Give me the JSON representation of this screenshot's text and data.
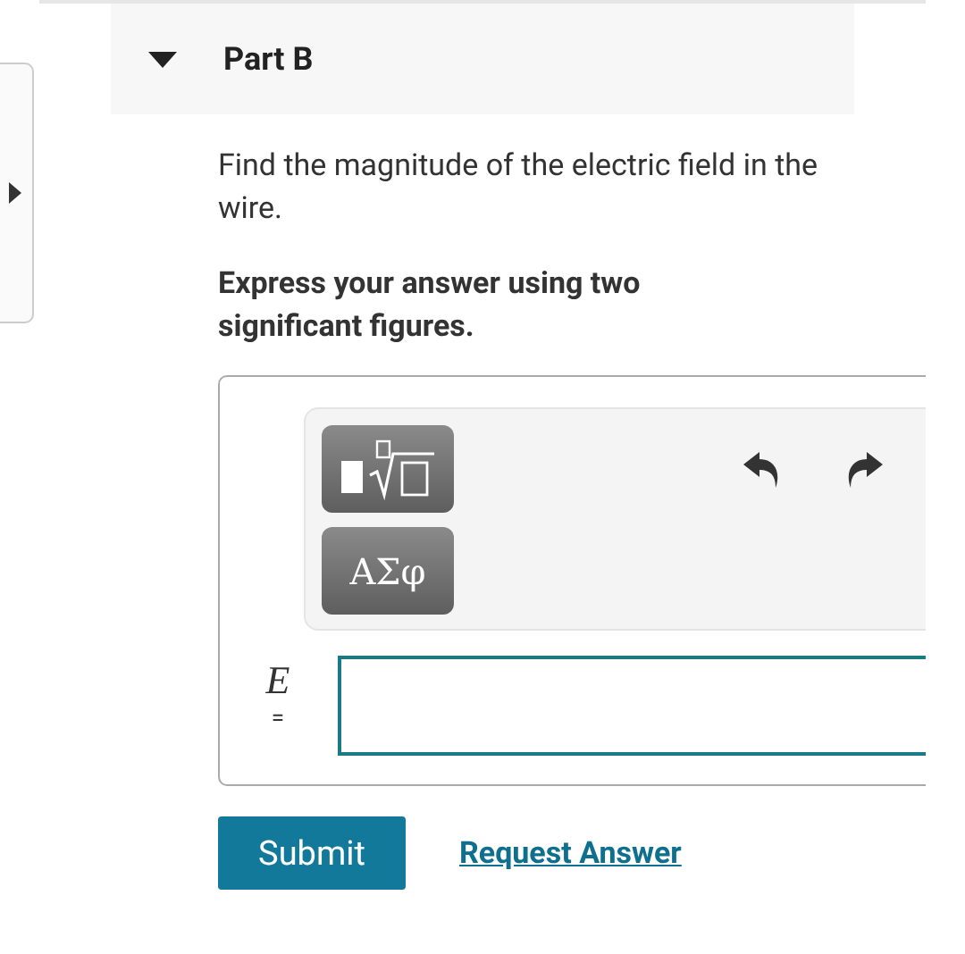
{
  "part": {
    "title": "Part B",
    "expanded": true
  },
  "question": "Find the magnitude of the electric field in the wire.",
  "instruction": "Express your answer using two significant figures.",
  "toolbar": {
    "symbol_button": "ΑΣφ"
  },
  "answer": {
    "variable": "E",
    "equals": "="
  },
  "buttons": {
    "submit": "Submit",
    "request": "Request Answer"
  }
}
